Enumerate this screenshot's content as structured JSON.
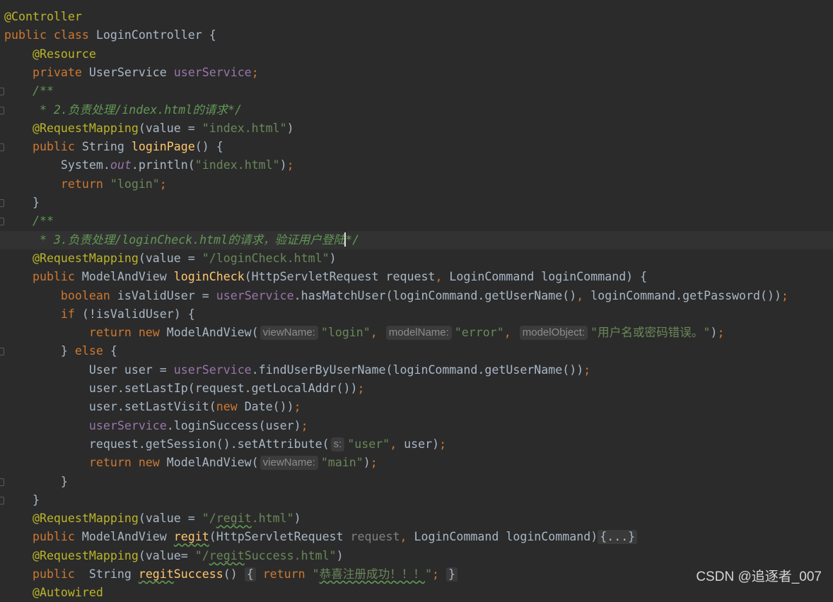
{
  "editor": {
    "lines": [
      [
        [
          "@Controller",
          "ann"
        ]
      ],
      [
        [
          "public class ",
          "kw"
        ],
        [
          "LoginController {",
          ""
        ]
      ],
      [
        [
          "    @Resource",
          "ann"
        ]
      ],
      [
        [
          "    private ",
          "kw"
        ],
        [
          "UserService ",
          ""
        ],
        [
          "userService",
          "field"
        ],
        [
          ";",
          "kw"
        ]
      ],
      [
        [
          "    /**",
          "cmt"
        ]
      ],
      [
        [
          "     * 2.",
          "cmt"
        ],
        [
          "负责处理",
          "cmt cjk"
        ],
        [
          "/index.html",
          "cmt"
        ],
        [
          "的请求",
          "cmt cjk"
        ],
        [
          "*/",
          "cmt"
        ]
      ],
      [
        [
          "    @RequestMapping",
          "ann"
        ],
        [
          "(value = ",
          ""
        ],
        [
          "\"index.html\"",
          "str"
        ],
        [
          ")",
          ""
        ]
      ],
      [
        [
          "    public ",
          "kw"
        ],
        [
          "String ",
          ""
        ],
        [
          "loginPage",
          "fn"
        ],
        [
          "() {",
          ""
        ]
      ],
      [
        [
          "        System.",
          ""
        ],
        [
          "out",
          "sfield"
        ],
        [
          ".println(",
          ""
        ],
        [
          "\"index.html\"",
          "str"
        ],
        [
          ")",
          ""
        ],
        [
          ";",
          "kw"
        ]
      ],
      [
        [
          "        return ",
          "kw"
        ],
        [
          "\"login\"",
          "str"
        ],
        [
          ";",
          "kw"
        ]
      ],
      [
        [
          "    }",
          ""
        ]
      ],
      [
        [
          "    /**",
          "cmt"
        ]
      ],
      [
        [
          "     * 3.",
          "cmt"
        ],
        [
          "负责处理",
          "cmt cjk"
        ],
        [
          "/loginCheck.html",
          "cmt"
        ],
        [
          "的请求，验证用户登陆",
          "cmt cjk"
        ],
        [
          "",
          "caret"
        ],
        [
          "*/",
          "cmt"
        ]
      ],
      [
        [
          "    @RequestMapping",
          "ann"
        ],
        [
          "(value = ",
          ""
        ],
        [
          "\"/loginCheck.html\"",
          "str"
        ],
        [
          ")",
          ""
        ]
      ],
      [
        [
          "    public ",
          "kw"
        ],
        [
          "ModelAndView ",
          ""
        ],
        [
          "loginCheck",
          "fn"
        ],
        [
          "(HttpServletRequest request",
          ""
        ],
        [
          ", ",
          "kw"
        ],
        [
          "LoginCommand loginCommand) {",
          ""
        ]
      ],
      [
        [
          "        boolean ",
          "kw"
        ],
        [
          "isValidUser = ",
          ""
        ],
        [
          "userService",
          "field"
        ],
        [
          ".hasMatchUser(loginCommand.getUserName()",
          ""
        ],
        [
          ", ",
          "kw"
        ],
        [
          "loginCommand.getPassword())",
          ""
        ],
        [
          ";",
          "kw"
        ]
      ],
      [
        [
          "        if ",
          "kw"
        ],
        [
          "(!isValidUser) {",
          ""
        ]
      ],
      [
        [
          "            return new ",
          "kw"
        ],
        [
          "ModelAndView(",
          ""
        ],
        [
          "viewName:",
          "hint"
        ],
        [
          "\"login\"",
          "str"
        ],
        [
          ", ",
          "kw"
        ],
        [
          "modelName:",
          "hint"
        ],
        [
          "\"error\"",
          "str"
        ],
        [
          ", ",
          "kw"
        ],
        [
          "modelObject:",
          "hint"
        ],
        [
          "\"",
          "str"
        ],
        [
          "用户名或密码错误。",
          "str cjk"
        ],
        [
          "\"",
          "str"
        ],
        [
          ")",
          ""
        ],
        [
          ";",
          "kw"
        ]
      ],
      [
        [
          "        } ",
          ""
        ],
        [
          "else ",
          "kw"
        ],
        [
          "{",
          ""
        ]
      ],
      [
        [
          "            User user = ",
          ""
        ],
        [
          "userService",
          "field"
        ],
        [
          ".findUserByUserName(loginCommand.getUserName())",
          ""
        ],
        [
          ";",
          "kw"
        ]
      ],
      [
        [
          "            user.setLastIp(request.getLocalAddr())",
          ""
        ],
        [
          ";",
          "kw"
        ]
      ],
      [
        [
          "            user.setLastVisit(",
          ""
        ],
        [
          "new ",
          "kw"
        ],
        [
          "Date())",
          ""
        ],
        [
          ";",
          "kw"
        ]
      ],
      [
        [
          "            ",
          ""
        ],
        [
          "userService",
          "field"
        ],
        [
          ".loginSuccess(user)",
          ""
        ],
        [
          ";",
          "kw"
        ]
      ],
      [
        [
          "            request.getSession().setAttribute(",
          ""
        ],
        [
          "s:",
          "hint"
        ],
        [
          "\"user\"",
          "str"
        ],
        [
          ", ",
          "kw"
        ],
        [
          "user)",
          ""
        ],
        [
          ";",
          "kw"
        ]
      ],
      [
        [
          "            return new ",
          "kw"
        ],
        [
          "ModelAndView(",
          ""
        ],
        [
          "viewName:",
          "hint"
        ],
        [
          "\"main\"",
          "str"
        ],
        [
          ")",
          ""
        ],
        [
          ";",
          "kw"
        ]
      ],
      [
        [
          "        }",
          ""
        ]
      ],
      [
        [
          "    }",
          ""
        ]
      ],
      [
        [
          "    @RequestMapping",
          "ann"
        ],
        [
          "(value = ",
          ""
        ],
        [
          "\"/",
          "str"
        ],
        [
          "regit",
          "str typo"
        ],
        [
          ".html\"",
          "str"
        ],
        [
          ")",
          ""
        ]
      ],
      [
        [
          "    public ",
          "kw"
        ],
        [
          "ModelAndView ",
          ""
        ],
        [
          "regit",
          "fn typo"
        ],
        [
          "(HttpServletRequest ",
          ""
        ],
        [
          "request",
          "param"
        ],
        [
          ", ",
          "kw"
        ],
        [
          "LoginCommand loginCommand)",
          ""
        ],
        [
          "{...}",
          "fold"
        ]
      ],
      [
        [
          "    @RequestMapping",
          "ann"
        ],
        [
          "(value= ",
          ""
        ],
        [
          "\"/",
          "str"
        ],
        [
          "regit",
          "str typo"
        ],
        [
          "Success.html\"",
          "str"
        ],
        [
          ")",
          ""
        ]
      ],
      [
        [
          "    public  ",
          "kw"
        ],
        [
          "String ",
          ""
        ],
        [
          "regit",
          "fn typo"
        ],
        [
          "Success",
          "fn"
        ],
        [
          "() ",
          ""
        ],
        [
          "{",
          "fold"
        ],
        [
          " return ",
          "kw"
        ],
        [
          "\"",
          "str"
        ],
        [
          "恭喜注册成功！！！",
          "str cjk typo"
        ],
        [
          "\"",
          "str"
        ],
        [
          "; ",
          "kw"
        ],
        [
          "}",
          "fold"
        ]
      ],
      [
        [
          "    @Autowired",
          "ann"
        ]
      ]
    ]
  },
  "watermark": "CSDN @追逐者_007"
}
